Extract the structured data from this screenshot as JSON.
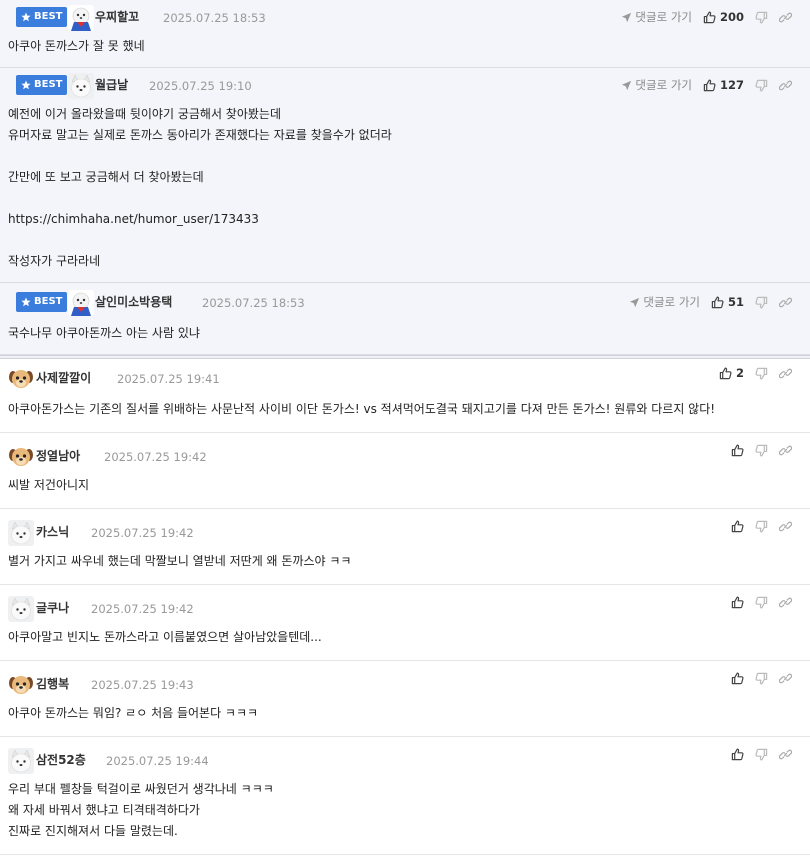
{
  "labels": {
    "best": "BEST",
    "reply": "댓글로 가기"
  },
  "colors": {
    "best_badge": "#3b7ddd",
    "best_bg": "#f3f5fa"
  },
  "best_comments": [
    {
      "nick": "우찌할꼬",
      "date": "2025.07.25 18:53",
      "likes": "200",
      "avatar": "dog-costume-avatar",
      "body": "아쿠아 돈까스가 잘 못 했네"
    },
    {
      "nick": "월급날",
      "date": "2025.07.25 19:10",
      "likes": "127",
      "avatar": "white-dog-avatar",
      "body": "예전에 이거 올라왔을때 뒷이야기 궁금해서 찾아봤는데\n유머자료 말고는 실제로 돈까스 동아리가 존재했다는 자료를 찾을수가 없더라\n\n간만에 또 보고 궁금해서 더 찾아봤는데\n\nhttps://chimhaha.net/humor_user/173433\n\n작성자가 구라라네"
    },
    {
      "nick": "살인미소박용택",
      "date": "2025.07.25 18:53",
      "likes": "51",
      "avatar": "dog-costume-avatar",
      "body": "국수나무 아쿠아돈까스 아는 사람 있냐"
    }
  ],
  "comments": [
    {
      "nick": "사제깔깔이",
      "date": "2025.07.25 19:41",
      "likes": "2",
      "avatar": "puppy-avatar",
      "body": "아쿠아돈가스는 기존의 질서를 위배하는 사문난적 사이비 이단 돈가스! vs 적셔먹어도결국 돼지고기를 다져 만든 돈가스! 원류와 다르지 않다!"
    },
    {
      "nick": "정열남아",
      "date": "2025.07.25 19:42",
      "likes": "",
      "avatar": "puppy-avatar",
      "body": "씨발 저건아니지"
    },
    {
      "nick": "카스닉",
      "date": "2025.07.25 19:42",
      "likes": "",
      "avatar": "white-dog-avatar",
      "body": "별거 가지고 싸우네 했는데 막짤보니 열받네 저딴게 왜 돈까스야 ㅋㅋ"
    },
    {
      "nick": "글쿠나",
      "date": "2025.07.25 19:42",
      "likes": "",
      "avatar": "white-dog-avatar",
      "body": "아쿠아말고 빈지노 돈까스라고 이름붙였으면 살아남았을텐데..."
    },
    {
      "nick": "김행복",
      "date": "2025.07.25 19:43",
      "likes": "",
      "avatar": "puppy-avatar",
      "body": "아쿠아 돈까스는 뭐임? ㄹㅇ 처음 들어본다 ㅋㅋㅋ"
    },
    {
      "nick": "삼전52층",
      "date": "2025.07.25 19:44",
      "likes": "",
      "avatar": "white-dog-avatar",
      "body": "우리 부대 펠창들 턱걸이로 싸웠던거 생각나네 ㅋㅋㅋ\n왜 자세 바꿔서 했냐고 티격태격하다가\n진짜로 진지해져서 다들 말렸는데."
    }
  ]
}
